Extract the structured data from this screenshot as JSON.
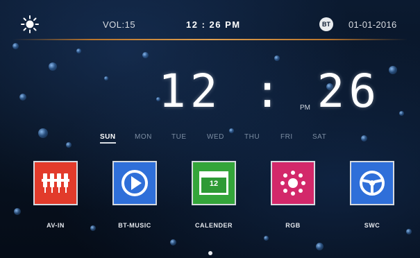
{
  "status_bar": {
    "brightness_icon": "sun-icon",
    "volume": "VOL:15",
    "time": "12 : 26 PM",
    "bluetooth_icon": "bt-icon",
    "bluetooth_glyph": "BT",
    "date": "01-01-2016",
    "accent_color": "#d9913a"
  },
  "clock": {
    "time": "12 : 26",
    "ampm": "PM"
  },
  "weekdays": {
    "selected": "SUN",
    "items": [
      {
        "label": "SUN",
        "active": true
      },
      {
        "label": "MON",
        "active": false
      },
      {
        "label": "TUE",
        "active": false
      },
      {
        "label": "WED",
        "active": false
      },
      {
        "label": "THU",
        "active": false
      },
      {
        "label": "FRI",
        "active": false
      },
      {
        "label": "SAT",
        "active": false
      }
    ]
  },
  "apps": [
    {
      "label": "AV-IN",
      "icon": "av-in-icon",
      "color": "#e23b2b"
    },
    {
      "label": "BT-MUSIC",
      "icon": "play-icon",
      "color": "#2f6fd9"
    },
    {
      "label": "CALENDER",
      "icon": "calendar-icon",
      "color": "#34a53a",
      "icon_text": "12"
    },
    {
      "label": "RGB",
      "icon": "rgb-light-icon",
      "color": "#d3286a"
    },
    {
      "label": "SWC",
      "icon": "steering-wheel-icon",
      "color": "#2f6fd9"
    }
  ]
}
